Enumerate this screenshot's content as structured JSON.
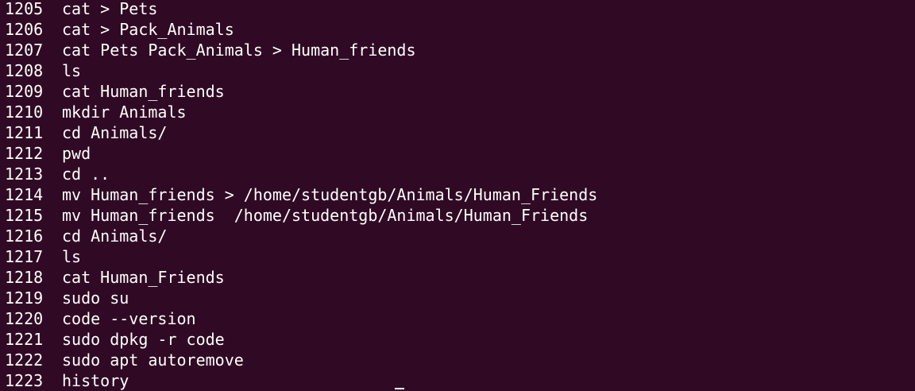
{
  "terminal": {
    "history": [
      {
        "num": "1205",
        "cmd": "cat > Pets"
      },
      {
        "num": "1206",
        "cmd": "cat > Pack_Animals"
      },
      {
        "num": "1207",
        "cmd": "cat Pets Pack_Animals > Human_friends"
      },
      {
        "num": "1208",
        "cmd": "ls"
      },
      {
        "num": "1209",
        "cmd": "cat Human_friends"
      },
      {
        "num": "1210",
        "cmd": "mkdir Animals"
      },
      {
        "num": "1211",
        "cmd": "cd Animals/"
      },
      {
        "num": "1212",
        "cmd": "pwd"
      },
      {
        "num": "1213",
        "cmd": "cd .."
      },
      {
        "num": "1214",
        "cmd": "mv Human_friends > /home/studentgb/Animals/Human_Friends"
      },
      {
        "num": "1215",
        "cmd": "mv Human_friends  /home/studentgb/Animals/Human_Friends"
      },
      {
        "num": "1216",
        "cmd": "cd Animals/"
      },
      {
        "num": "1217",
        "cmd": "ls"
      },
      {
        "num": "1218",
        "cmd": "cat Human_Friends"
      },
      {
        "num": "1219",
        "cmd": "sudo su"
      },
      {
        "num": "1220",
        "cmd": "code --version"
      },
      {
        "num": "1221",
        "cmd": "sudo dpkg -r code"
      },
      {
        "num": "1222",
        "cmd": "sudo apt autoremove"
      },
      {
        "num": "1223",
        "cmd": "history"
      }
    ],
    "colors": {
      "background": "#300a24",
      "foreground": "#ffffff"
    }
  }
}
